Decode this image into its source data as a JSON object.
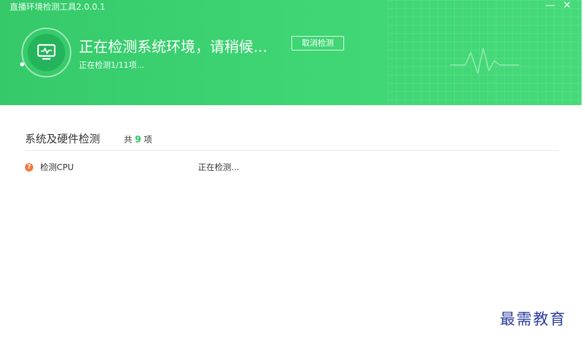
{
  "window": {
    "title": "直播环境检测工具2.0.0.1",
    "minimize_glyph": "—",
    "close_glyph": "✕"
  },
  "header": {
    "status_main": "正在检测系统环境，请稍候...",
    "status_sub": "正在检测1/11项...",
    "cancel_label": "取消检测",
    "icon": "monitor-pulse-icon",
    "accent_color": "#3fd674"
  },
  "section": {
    "title": "系统及硬件检测",
    "count_prefix": "共",
    "count_value": "9",
    "count_suffix": "项"
  },
  "items": [
    {
      "icon": "question-icon",
      "icon_glyph": "?",
      "label": "检测CPU",
      "status": "正在检测..."
    }
  ],
  "watermark": "最需教育"
}
